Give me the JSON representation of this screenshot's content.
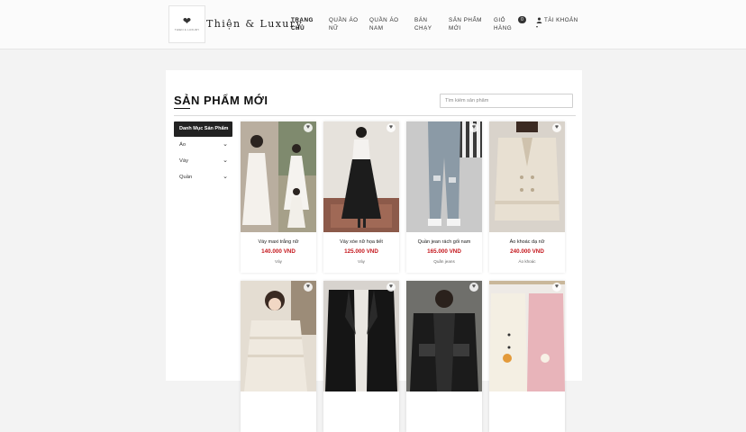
{
  "header": {
    "logo_icon": "heart-logo-icon",
    "logo_small_text": "THIEN & LUXURY",
    "brand": "Thiện & Luxury",
    "nav": [
      {
        "line1": "TRANG",
        "line2": "CHỦ"
      },
      {
        "line1": "QUẦN ÁO",
        "line2": "NỮ"
      },
      {
        "line1": "QUẦN ÁO",
        "line2": "NAM"
      },
      {
        "line1": "BÁN",
        "line2": "CHẠY"
      },
      {
        "line1": "SẢN PHẨM",
        "line2": "MỚI"
      },
      {
        "line1": "GIỎ",
        "line2": "HÀNG"
      }
    ],
    "cart_count": "0",
    "account_label": "TÀI KHOẢN",
    "account_icon": "user-icon",
    "account_caret": "▾"
  },
  "main": {
    "title": "SẢN PHẨM MỚI",
    "search_placeholder": "Tìm kiếm sản phẩm"
  },
  "sidebar": {
    "heading": "Danh Mục Sản Phẩm",
    "items": [
      {
        "label": "Áo",
        "icon": "chevron-down-icon"
      },
      {
        "label": "Váy",
        "icon": "chevron-down-icon"
      },
      {
        "label": "Quần",
        "icon": "chevron-down-icon"
      }
    ]
  },
  "products": [
    {
      "name": "Váy maxi trắng nữ",
      "price": "140.000 VND",
      "category": "Váy"
    },
    {
      "name": "Váy xòe nữ họa tiết",
      "price": "125.000 VND",
      "category": "Váy"
    },
    {
      "name": "Quần jean rách gối nam",
      "price": "165.000 VND",
      "category": "Quần jeans"
    },
    {
      "name": "Áo khoác dạ nữ",
      "price": "240.000 VND",
      "category": "Áo khoác"
    },
    {
      "name": "",
      "price": "",
      "category": ""
    },
    {
      "name": "",
      "price": "",
      "category": ""
    },
    {
      "name": "",
      "price": "",
      "category": ""
    },
    {
      "name": "",
      "price": "",
      "category": ""
    }
  ],
  "colors": {
    "price": "#c4161c",
    "dark": "#222222"
  }
}
